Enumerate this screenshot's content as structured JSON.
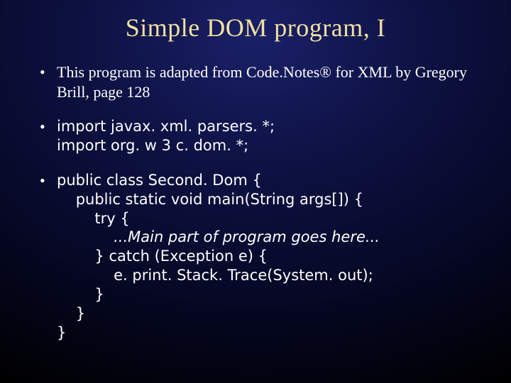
{
  "title": "Simple DOM program, I",
  "bullets": {
    "b1": "This program is adapted from Code.Notes® for XML by Gregory Brill, page 128",
    "b2_line1": "import javax. xml. parsers. *;",
    "b2_line2": "import org. w 3 c. dom. *;",
    "b3_line1": "public class Second. Dom {",
    "b3_line2": "    public static void main(String args[]) {",
    "b3_line3": "        try {",
    "b3_line4": "            ...Main part of program goes here...",
    "b3_line5": "        } catch (Exception e) {",
    "b3_line6": "            e. print. Stack. Trace(System. out);",
    "b3_line7": "        }",
    "b3_line8": "    }",
    "b3_line9": "}"
  }
}
